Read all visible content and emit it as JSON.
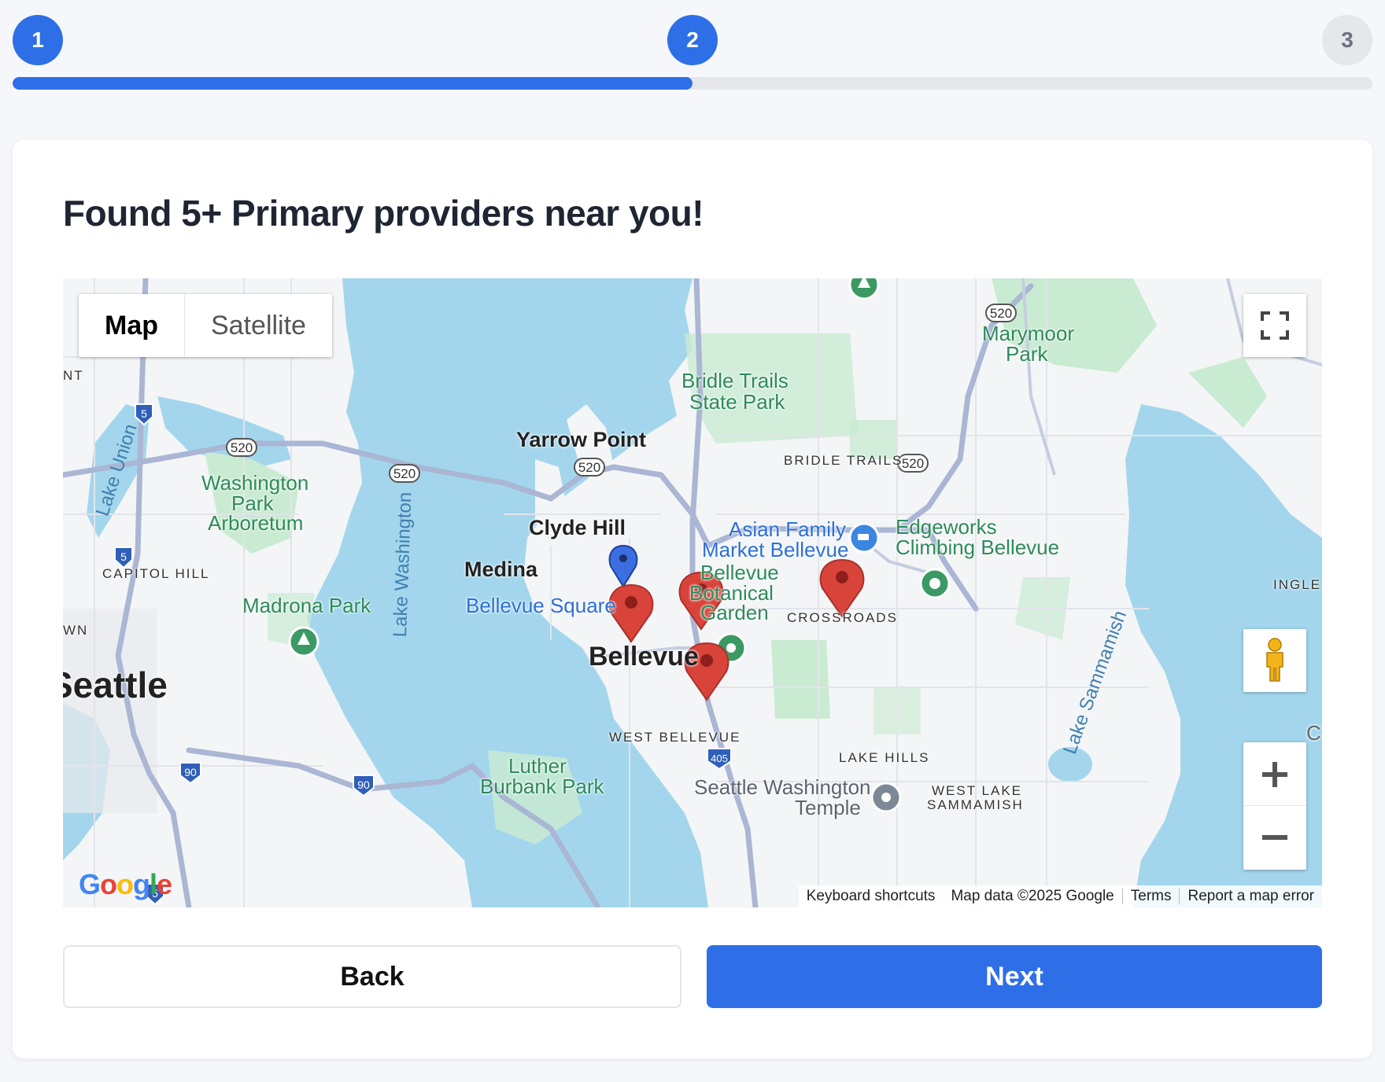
{
  "stepper": {
    "steps": [
      {
        "label": "1",
        "state": "complete"
      },
      {
        "label": "2",
        "state": "current"
      },
      {
        "label": "3",
        "state": "upcoming"
      }
    ],
    "progress_fraction": 0.5
  },
  "heading": "Found 5+ Primary providers near you!",
  "map": {
    "type_control": {
      "map": "Map",
      "satellite": "Satellite",
      "selected": "Map"
    },
    "labels": {
      "yarrow_point": "Yarrow Point",
      "clyde_hill": "Clyde Hill",
      "medina": "Medina",
      "bellevue": "Bellevue",
      "seattle": "Seattle",
      "bellevue_square": "Bellevue Square",
      "asian_family_market_l1": "Asian Family",
      "asian_family_market_l2": "Market Bellevue",
      "edgeworks_l1": "Edgeworks",
      "edgeworks_l2": "Climbing Bellevue",
      "bridle_trails_park_l1": "Bridle Trails",
      "bridle_trails_park_l2": "State Park",
      "marymoor_l1": "Marymoor",
      "marymoor_l2": "Park",
      "washington_park_l1": "Washington",
      "washington_park_l2": "Park",
      "washington_park_l3": "Arboretum",
      "madrona_park": "Madrona Park",
      "botanical_l1": "Bellevue",
      "botanical_l2": "Botanical",
      "botanical_l3": "Garden",
      "luther_l1": "Luther",
      "luther_l2": "Burbank Park",
      "temple_l1": "Seattle Washington",
      "temple_l2": "Temple",
      "bridle_trails": "BRIDLE TRAILS",
      "crossroads": "CROSSROADS",
      "west_bellevue": "WEST BELLEVUE",
      "lake_hills": "LAKE HILLS",
      "west_lake_sammamish_l1": "WEST LAKE",
      "west_lake_sammamish_l2": "SAMMAMISH",
      "capitol_hill": "CAPITOL HILL",
      "ingle": "INGLE",
      "nt": "NT",
      "wn": "WN",
      "lake_union": "Lake Union",
      "lake_washington": "Lake Washington",
      "lake_sammamish": "Lake Sammamish",
      "c_edge": "C"
    },
    "highway_shields": [
      "520",
      "520",
      "520",
      "520",
      "520",
      "5",
      "5",
      "90",
      "90",
      "405",
      "5"
    ],
    "provider_marker_count": 4,
    "user_marker": "blue-location-pin",
    "google_logo": "Google",
    "attribution": {
      "shortcuts": "Keyboard shortcuts",
      "data": "Map data ©2025 Google",
      "terms": "Terms",
      "report": "Report a map error"
    },
    "colors": {
      "water": "#a3d6ec",
      "park": "#c9ebd2",
      "road": "#aab6d3",
      "pin": "#d9443a",
      "user_pin": "#3b6fe0"
    }
  },
  "buttons": {
    "back": "Back",
    "next": "Next"
  },
  "colors": {
    "accent": "#2e6fe8",
    "inactive_step": "#e5e7eb"
  }
}
